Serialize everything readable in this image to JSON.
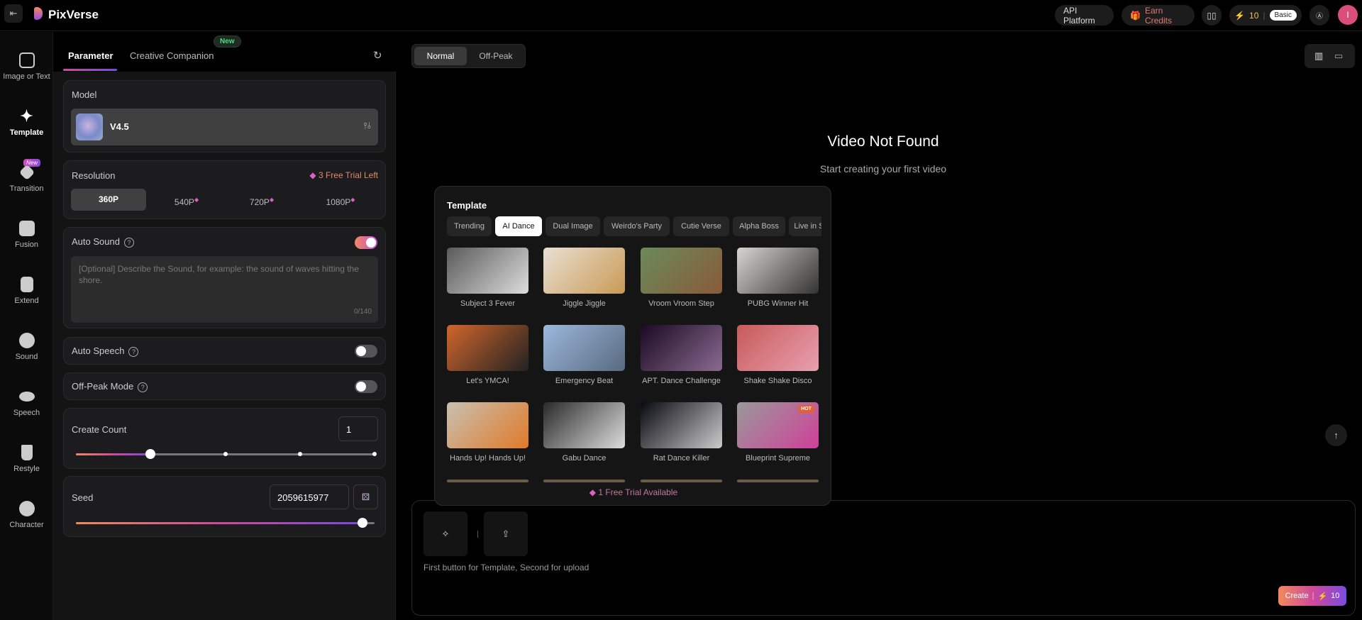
{
  "header": {
    "brand": "PixVerse",
    "api_platform": "API Platform",
    "earn_credits": "Earn Credits",
    "credits": "10",
    "plan": "Basic",
    "avatar_initial": "I"
  },
  "rail": [
    {
      "label": "Image or Text"
    },
    {
      "label": "Template"
    },
    {
      "label": "Transition",
      "badge": "New"
    },
    {
      "label": "Fusion"
    },
    {
      "label": "Extend"
    },
    {
      "label": "Sound"
    },
    {
      "label": "Speech"
    },
    {
      "label": "Restyle"
    },
    {
      "label": "Character"
    }
  ],
  "panel": {
    "tabs": {
      "parameter": "Parameter",
      "creative": "Creative Companion",
      "new_badge": "New"
    },
    "model": {
      "label": "Model",
      "value": "V4.5"
    },
    "resolution": {
      "label": "Resolution",
      "trial": "3 Free Trial Left",
      "options": [
        "360P",
        "540P",
        "720P",
        "1080P"
      ],
      "selected": "360P"
    },
    "auto_sound": {
      "label": "Auto Sound",
      "enabled": true,
      "placeholder": "[Optional] Describe the Sound, for example: the sound of waves hitting the shore.",
      "counter": "0/140"
    },
    "auto_speech": {
      "label": "Auto Speech",
      "enabled": false
    },
    "off_peak": {
      "label": "Off-Peak Mode",
      "enabled": false
    },
    "create_count": {
      "label": "Create Count",
      "value": "1",
      "slider_max": 4
    },
    "seed": {
      "label": "Seed",
      "value": "2059615977",
      "slider_fraction": 0.96
    }
  },
  "main": {
    "mode_tabs": [
      "Normal",
      "Off-Peak"
    ],
    "empty_title": "Video Not Found",
    "empty_sub": "Start creating your first video",
    "prompt_hint": "First button for Template, Second for upload",
    "create_label": "Create",
    "create_cost": "10"
  },
  "template": {
    "title": "Template",
    "categories": [
      "Trending",
      "AI Dance",
      "Dual Image",
      "Weirdo's Party",
      "Cutie Verse",
      "Alpha Boss",
      "Live in St"
    ],
    "active": "AI Dance",
    "items": [
      {
        "name": "Subject 3 Fever",
        "c1": "#5a5a5a",
        "c2": "#ddd"
      },
      {
        "name": "Jiggle Jiggle",
        "c1": "#e8e0d4",
        "c2": "#c99a55"
      },
      {
        "name": "Vroom Vroom Step",
        "c1": "#6a8a5a",
        "c2": "#8a5a3a"
      },
      {
        "name": "PUBG Winner Hit",
        "c1": "#d8d4d0",
        "c2": "#333"
      },
      {
        "name": "Let's YMCA!",
        "c1": "#d2652c",
        "c2": "#222"
      },
      {
        "name": "Emergency Beat",
        "c1": "#9cb8dc",
        "c2": "#596a80"
      },
      {
        "name": "APT. Dance Challenge",
        "c1": "#1a0a22",
        "c2": "#8a6a90"
      },
      {
        "name": "Shake Shake Disco",
        "c1": "#c85a5a",
        "c2": "#e8a0b0"
      },
      {
        "name": "Hands Up! Hands Up!",
        "c1": "#c8c0b0",
        "c2": "#e07a2a"
      },
      {
        "name": "Gabu Dance",
        "c1": "#2a2a2a",
        "c2": "#ddd"
      },
      {
        "name": "Rat Dance Killer",
        "c1": "#080810",
        "c2": "#ccc"
      },
      {
        "name": "Blueprint Supreme",
        "c1": "#999",
        "c2": "#d0409a",
        "badge": "HOT"
      }
    ],
    "trial": "1 Free Trial Available"
  }
}
